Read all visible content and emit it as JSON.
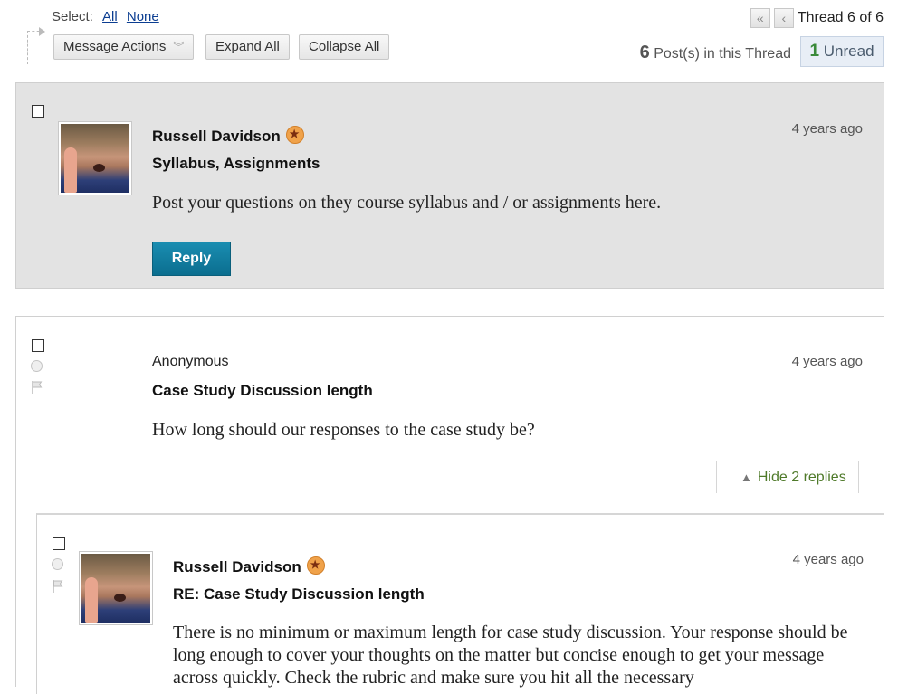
{
  "toolbar": {
    "select_label": "Select:",
    "select_all": "All",
    "select_none": "None",
    "message_actions": "Message Actions",
    "expand_all": "Expand All",
    "collapse_all": "Collapse All"
  },
  "pager": {
    "thread_label": "Thread 6 of 6",
    "posts_count": "6",
    "posts_suffix": " Post(s) in this Thread",
    "unread_count": "1",
    "unread_label": " Unread"
  },
  "posts": [
    {
      "author": "Russell Davidson",
      "subject": "Syllabus, Assignments",
      "body": "Post your questions on they course syllabus and / or assignments here.",
      "time": "4 years ago",
      "reply_label": "Reply"
    },
    {
      "author": "Anonymous",
      "subject": "Case Study Discussion length",
      "body": "How long should our responses to the case study be?",
      "time": "4 years ago",
      "replies_toggle": "Hide 2 replies"
    },
    {
      "author": "Russell Davidson",
      "subject": "RE: Case Study Discussion length",
      "body": "There is no minimum or maximum length for case study discussion. Your response should be long enough to cover your thoughts on the matter but concise enough to get your message across quickly. Check the rubric and make sure you hit all the necessary",
      "time": "4 years ago"
    }
  ]
}
